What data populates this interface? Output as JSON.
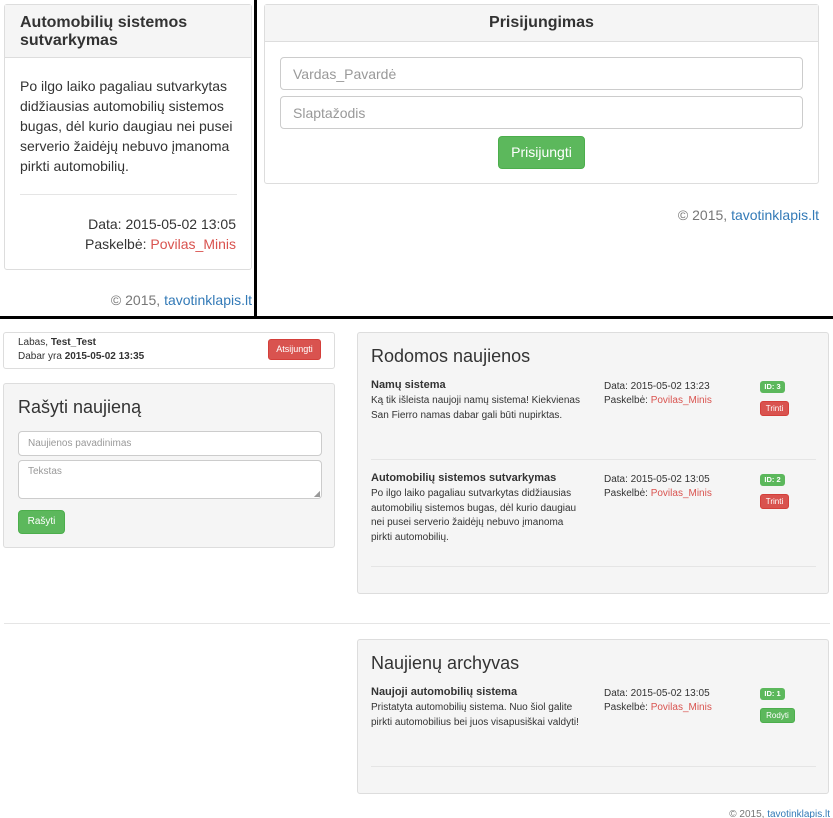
{
  "top_left": {
    "title": "Automobilių sistemos sutvarkymas",
    "body": "Po ilgo laiko pagaliau sutvarkytas didžiausias automobilių sistemos bugas, dėl kurio daugiau nei pusei serverio žaidėjų nebuvo įmanoma pirkti automobilių.",
    "date_label": "Data: 2015-05-02 13:05",
    "poster_label": "Paskelbė:",
    "poster": "Povilas_Minis",
    "footer_prefix": "© 2015,",
    "footer_link": "tavotinklapis.lt"
  },
  "login": {
    "title": "Prisijungimas",
    "username_placeholder": "Vardas_Pavardė",
    "password_placeholder": "Slaptažodis",
    "submit_label": "Prisijungti",
    "footer_prefix": "© 2015,",
    "footer_link": "tavotinklapis.lt"
  },
  "user_bar": {
    "greeting": "Labas,",
    "username": "Test_Test",
    "now_label": "Dabar yra",
    "now_value": "2015-05-02 13:35",
    "logout_label": "Atsijungti"
  },
  "write_news": {
    "title": "Rašyti naujieną",
    "title_placeholder": "Naujienos pavadinimas",
    "text_placeholder": "Tekstas",
    "submit_label": "Rašyti"
  },
  "shown_news": {
    "title": "Rodomos naujienos",
    "items": [
      {
        "title": "Namų sistema",
        "body": "Ką tik išleista naujoji namų sistema! Kiekvienas San Fierro namas dabar gali būti nupirktas.",
        "date": "Data: 2015-05-02 13:23",
        "poster_label": "Paskelbė:",
        "poster": "Povilas_Minis",
        "id": "ID: 3",
        "action": "Trinti"
      },
      {
        "title": "Automobilių sistemos sutvarkymas",
        "body": "Po ilgo laiko pagaliau sutvarkytas didžiausias automobilių sistemos bugas, dėl kurio daugiau nei pusei serverio žaidėjų nebuvo įmanoma pirkti automobilių.",
        "date": "Data: 2015-05-02 13:05",
        "poster_label": "Paskelbė:",
        "poster": "Povilas_Minis",
        "id": "ID: 2",
        "action": "Trinti"
      }
    ]
  },
  "archive": {
    "title": "Naujienų archyvas",
    "items": [
      {
        "title": "Naujoji automobilių sistema",
        "body": "Pristatyta automobilių sistema. Nuo šiol galite pirkti automobilius bei juos visapusiškai valdyti!",
        "date": "Data: 2015-05-02 13:05",
        "poster_label": "Paskelbė:",
        "poster": "Povilas_Minis",
        "id": "ID: 1",
        "action": "Rodyti"
      }
    ]
  },
  "bottom_footer": {
    "prefix": "© 2015,",
    "link": "tavotinklapis.lt"
  },
  "colors": {
    "green": "#5cb85c",
    "red": "#d9534f",
    "link": "#337ab7",
    "panel_border": "#dddddd"
  }
}
